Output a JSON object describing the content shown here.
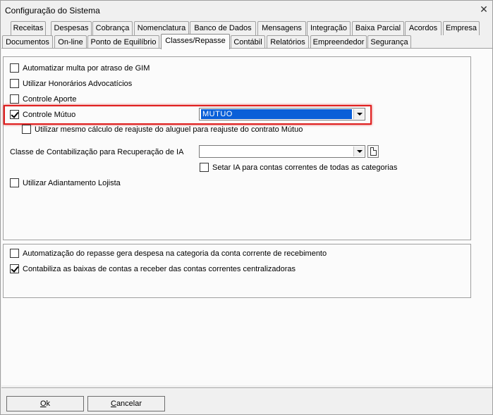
{
  "window": {
    "title": "Configuração do Sistema",
    "close_glyph": "✕"
  },
  "tabs_row1": [
    {
      "label": "Receitas"
    },
    {
      "label": "Despesas"
    },
    {
      "label": "Cobrança"
    },
    {
      "label": "Nomenclatura"
    },
    {
      "label": "Banco de Dados"
    },
    {
      "label": "Mensagens"
    },
    {
      "label": "Integração"
    },
    {
      "label": "Baixa Parcial"
    },
    {
      "label": "Acordos"
    },
    {
      "label": "Empresa"
    }
  ],
  "tabs_row2": [
    {
      "label": "Documentos"
    },
    {
      "label": "On-line"
    },
    {
      "label": "Ponto de Equilíbrio"
    },
    {
      "label": "Classes/Repasse"
    },
    {
      "label": "Contábil"
    },
    {
      "label": "Relatórios"
    },
    {
      "label": "Empreendedor"
    },
    {
      "label": "Segurança"
    }
  ],
  "active_tab": "Classes/Repasse",
  "group1": {
    "multa_gim": {
      "label": "Automatizar multa por atraso de GIM",
      "checked": false
    },
    "honorarios": {
      "label": "Utilizar Honorários Advocatícios",
      "checked": false
    },
    "aporte": {
      "label": "Controle Aporte",
      "checked": false
    },
    "mutuo": {
      "label": "Controle Mútuo",
      "checked": true,
      "combo_value": "MUTUO"
    },
    "reajuste": {
      "label": "Utilizar mesmo cálculo de reajuste do aluguel para reajuste do contrato Mútuo",
      "checked": false
    },
    "classe_label": "Classe de Contabilização para Recuperação de IA",
    "classe_combo_value": "",
    "setar_ia": {
      "label": "Setar IA para contas correntes de todas as categorias",
      "checked": false
    },
    "adiantamento": {
      "label": "Utilizar Adiantamento Lojista",
      "checked": false
    }
  },
  "group2": {
    "automatizacao": {
      "label": "Automatização do repasse gera despesa na categoria da conta corrente de recebimento",
      "checked": false
    },
    "contabiliza": {
      "label": "Contabiliza as baixas de contas a receber das contas correntes centralizadoras",
      "checked": true
    }
  },
  "buttons": {
    "ok": {
      "accel": "O",
      "rest": "k"
    },
    "cancel": {
      "accel": "C",
      "rest": "ancelar"
    }
  },
  "colors": {
    "highlight": "#e02020",
    "selection": "#0a5fd8"
  }
}
